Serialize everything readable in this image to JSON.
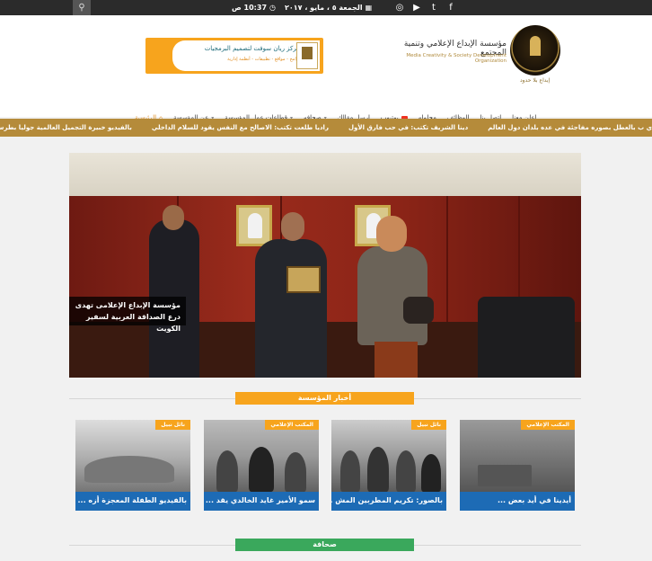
{
  "topbar": {
    "search_icon": "search-icon",
    "social": [
      "facebook-icon",
      "twitter-icon",
      "youtube-icon",
      "instagram-icon"
    ],
    "social_glyphs": [
      "f",
      "t",
      "▶",
      "◎"
    ],
    "date": "الجمعة ٥ ، مايو ، ٢٠١٧",
    "time": "10:37 ص"
  },
  "header": {
    "org_name_ar": "مؤسسة الإبداع الإعلامي وتنمية المجتمع",
    "org_name_en": "Media Creativity & Society Development Organization",
    "logo_tagline": "إبداع بلا حدود",
    "banner_title": "مركز ريان سوفت لتصميم البرمجيات",
    "banner_subtitle": "برامج - مواقع - تطبيقات - أنظمة إدارية"
  },
  "nav": {
    "items": [
      {
        "label": "الرئيسية",
        "icon": "home-icon",
        "glyph": "⌂"
      },
      {
        "label": "عن المؤسسة",
        "icon": "chevron-down-icon",
        "glyph": "▾"
      },
      {
        "label": "قطاعات عمل المؤسسة",
        "icon": "chevron-down-icon",
        "glyph": "▾"
      },
      {
        "label": "صحافه",
        "icon": "chevron-down-icon",
        "glyph": "▾"
      },
      {
        "label": "ارسل مقالك",
        "icon": "",
        "glyph": ""
      },
      {
        "label": "يوتيوب",
        "icon": "youtube-icon",
        "glyph": ""
      },
      {
        "label": "مجلوله",
        "icon": "",
        "glyph": ""
      },
      {
        "label": "الوظائف",
        "icon": "",
        "glyph": ""
      },
      {
        "label": "اتصل بنا",
        "icon": "",
        "glyph": ""
      },
      {
        "label": "اعلن معنا",
        "icon": "",
        "glyph": ""
      }
    ]
  },
  "ticker": {
    "items": [
      "ي ب بالعطل بصوره مفاجئة في عده بلدان دول العالم",
      "دينا الشريف تكتب: في حب فارق الأول",
      "راديا طلعت تكتب: الاصالح مع النفس يقود للسلام الداخلي",
      "بالفيديو خبيرة التجميل العالمية جوليا بطرس تثير قضية العنف ضد المرأة بفن التجميل"
    ]
  },
  "slider": {
    "caption": "مؤسسة الإبداع الإعلامى تهدى درع الصداقة العربية لسفير الكويت"
  },
  "sections": {
    "news_title": "أخبار المؤسسة",
    "press_title": "صحافة"
  },
  "cards": [
    {
      "tag": "نائل نبيل",
      "title": "بالفيديو الطفلة المعجزة أزه ..."
    },
    {
      "tag": "المكتب الإعلامي",
      "title": "سمو الأمير غايد الخالدي يقد ..."
    },
    {
      "tag": "نائل نبيل",
      "title": "بالصور: تكريم المطربين المش ..."
    },
    {
      "tag": "المكتب الإعلامي",
      "title": "أيدينا في أيد بعض ..."
    }
  ]
}
